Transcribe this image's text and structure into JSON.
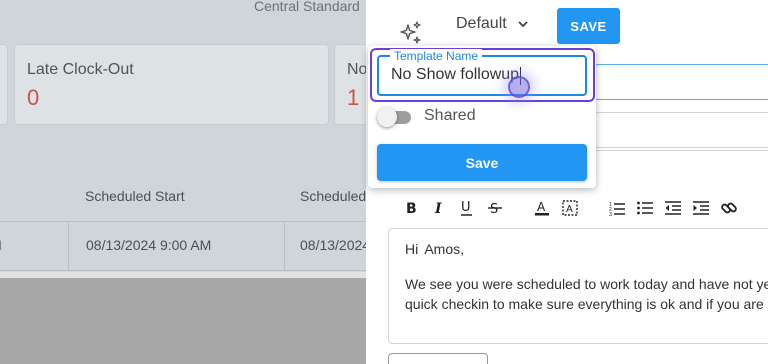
{
  "background": {
    "timezone_text": "Central Standard",
    "stats": [
      {
        "label": "",
        "value": ""
      },
      {
        "label": "Late Clock-Out",
        "value": "0"
      },
      {
        "label": "No",
        "value": "1"
      }
    ],
    "table": {
      "headers": [
        "Scheduled Start",
        "Scheduled"
      ],
      "row": [
        "08/13/2024 9:00 AM",
        "08/13/2024"
      ]
    }
  },
  "panel": {
    "template_select": "Default",
    "save_top_label": "SAVE",
    "popover": {
      "field_label": "Template Name",
      "field_value": "No Show followup",
      "toggle_label": "Shared",
      "toggle_on": false,
      "save_label": "Save"
    },
    "editor": {
      "greeting": "Hi  Amos,",
      "lines": [
        "We see you were scheduled to work today and have not yet cl",
        "quick checkin to make sure everything is ok and if you are still"
      ]
    },
    "toolbar_icons": [
      "bold-icon",
      "italic-icon",
      "underline-icon",
      "strikethrough-icon",
      "text-color-icon",
      "highlight-icon",
      "ordered-list-icon",
      "bullet-list-icon",
      "outdent-icon",
      "indent-icon",
      "link-icon"
    ],
    "colors": {
      "primary": "#2196f3",
      "focus": "#6a3fd9",
      "stat_value": "#c9534b"
    }
  }
}
